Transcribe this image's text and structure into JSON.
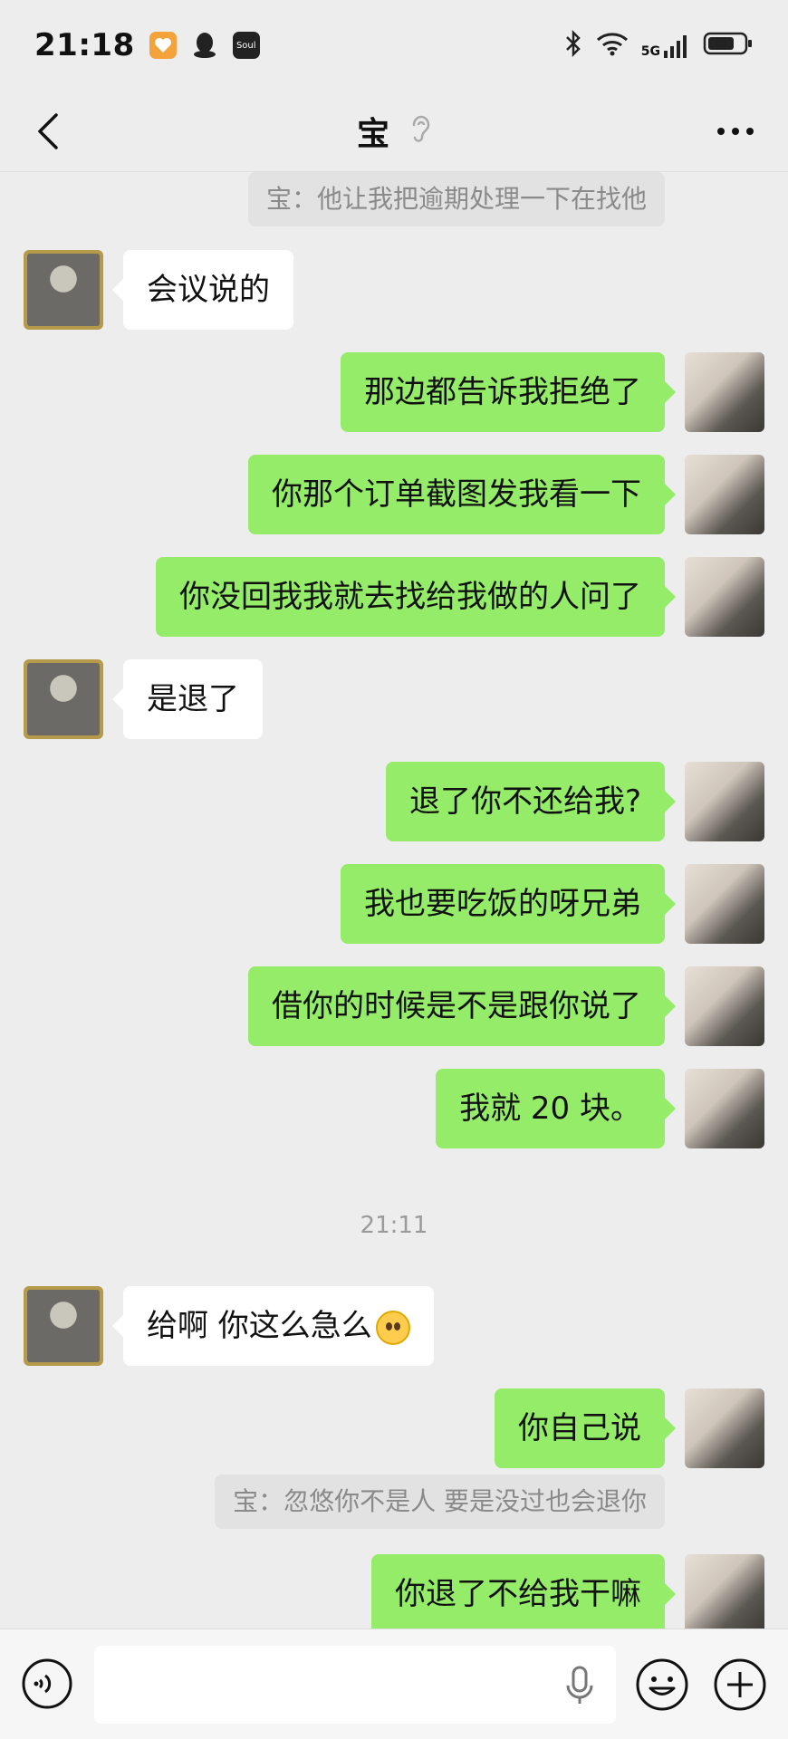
{
  "status_bar": {
    "time": "21:18",
    "network": "5G",
    "apps": [
      "heart-app-icon",
      "qq-icon",
      "soul-app-icon"
    ],
    "soul_label": "Soul"
  },
  "header": {
    "title": "宝",
    "icons": [
      "back-icon",
      "ear-icon",
      "more-icon"
    ]
  },
  "chat": {
    "quote_top": "宝：他让我把逾期处理一下在找他",
    "messages": [
      {
        "side": "left",
        "text": "会议说的"
      },
      {
        "side": "right",
        "text": "那边都告诉我拒绝了"
      },
      {
        "side": "right",
        "text": "你那个订单截图发我看一下"
      },
      {
        "side": "right",
        "text": "你没回我我就去找给我做的人问了"
      },
      {
        "side": "left",
        "text": "是退了"
      },
      {
        "side": "right",
        "text": "退了你不还给我?"
      },
      {
        "side": "right",
        "text": "我也要吃饭的呀兄弟"
      },
      {
        "side": "right",
        "text": "借你的时候是不是跟你说了"
      },
      {
        "side": "right",
        "text": "我就 20 块。"
      }
    ],
    "timestamp": "21:11",
    "messages_after": [
      {
        "side": "left",
        "text": "给啊 你这么急么",
        "emoji": "pleading-face-emoji"
      },
      {
        "side": "right",
        "text": "你自己说"
      }
    ],
    "quote_bottom": "宝：忽悠你不是人 要是没过也会退你",
    "last_message": {
      "side": "right",
      "text": "你退了不给我干嘛"
    }
  },
  "input_bar": {
    "placeholder": "",
    "icons": [
      "voice-icon",
      "mic-icon",
      "emoji-icon",
      "plus-icon"
    ]
  },
  "colors": {
    "background": "#ededed",
    "bubble_sent": "#95ec69",
    "bubble_received": "#ffffff"
  }
}
